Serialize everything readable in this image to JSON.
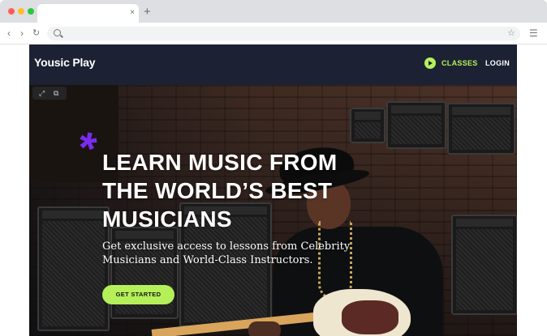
{
  "browser": {
    "tab_close": "×",
    "new_tab": "+",
    "traffic_colors": [
      "#ff5f57",
      "#febc2e",
      "#28c840"
    ]
  },
  "site": {
    "logo": "Yousic Play",
    "nav": {
      "classes_label": "CLASSES",
      "login_label": "LOGIN"
    },
    "hero": {
      "headline": "LEARN MUSIC FROM THE WORLD’S BEST MUSICIANS",
      "subheadline": "Get exclusive access to lessons from Celebrity Musicians and World-Class Instructors.",
      "cta_label": "GET STARTED",
      "accent": "*"
    },
    "colors": {
      "brand_green": "#b5f05a",
      "accent_purple": "#7a2bf0",
      "header_bg": "#1c2233"
    }
  }
}
